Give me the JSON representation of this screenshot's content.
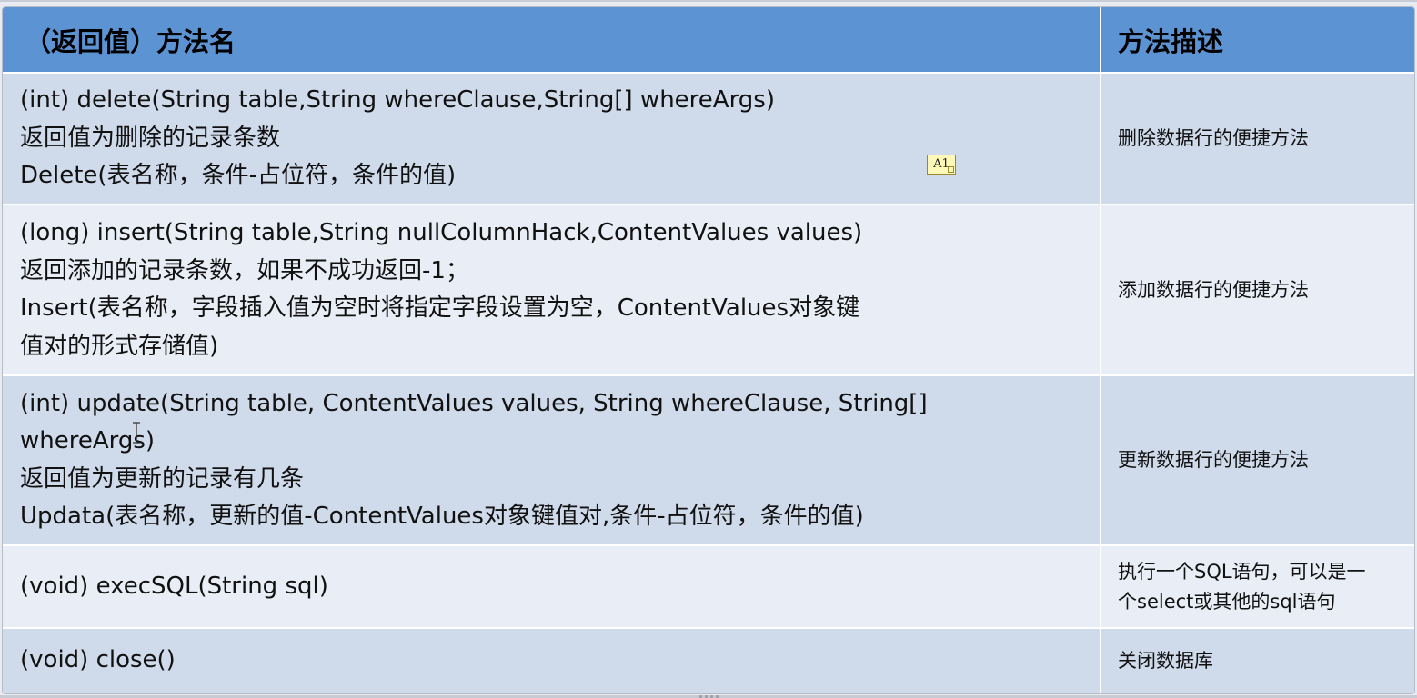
{
  "table": {
    "headers": [
      "（返回值）方法名",
      "方法描述"
    ],
    "rows": [
      {
        "method_lines": [
          "(int) delete(String table,String whereClause,String[] whereArgs)",
          "返回值为删除的记录条数",
          "Delete(表名称，条件-占位符，条件的值)"
        ],
        "description_lines": [
          "删除数据行的便捷方法"
        ]
      },
      {
        "method_lines": [
          "(long) insert(String table,String nullColumnHack,ContentValues values)",
          "返回添加的记录条数，如果不成功返回-1；",
          "Insert(表名称，字段插入值为空时将指定字段设置为空，ContentValues对象键",
          "值对的形式存储值)"
        ],
        "description_lines": [
          "添加数据行的便捷方法"
        ]
      },
      {
        "method_lines": [
          "(int) update(String table, ContentValues values, String whereClause, String[]",
          "whereArgs)",
          "返回值为更新的记录有几条",
          "Updata(表名称，更新的值-ContentValues对象键值对,条件-占位符，条件的值)"
        ],
        "description_lines": [
          "更新数据行的便捷方法"
        ]
      },
      {
        "method_lines": [
          "(void) execSQL(String sql)"
        ],
        "description_lines": [
          "执行一个SQL语句，可以是一",
          "个select或其他的sql语句"
        ]
      },
      {
        "method_lines": [
          "(void) close()"
        ],
        "description_lines": [
          "关闭数据库"
        ]
      }
    ]
  },
  "comment_marker": "A1",
  "icons": {
    "text_cursor": "text-cursor-icon",
    "scroll_grip": "grip-icon"
  },
  "colors": {
    "header_bg": "#5b93d3",
    "row_dark": "#cfdaea",
    "row_light": "#e9eef6"
  }
}
